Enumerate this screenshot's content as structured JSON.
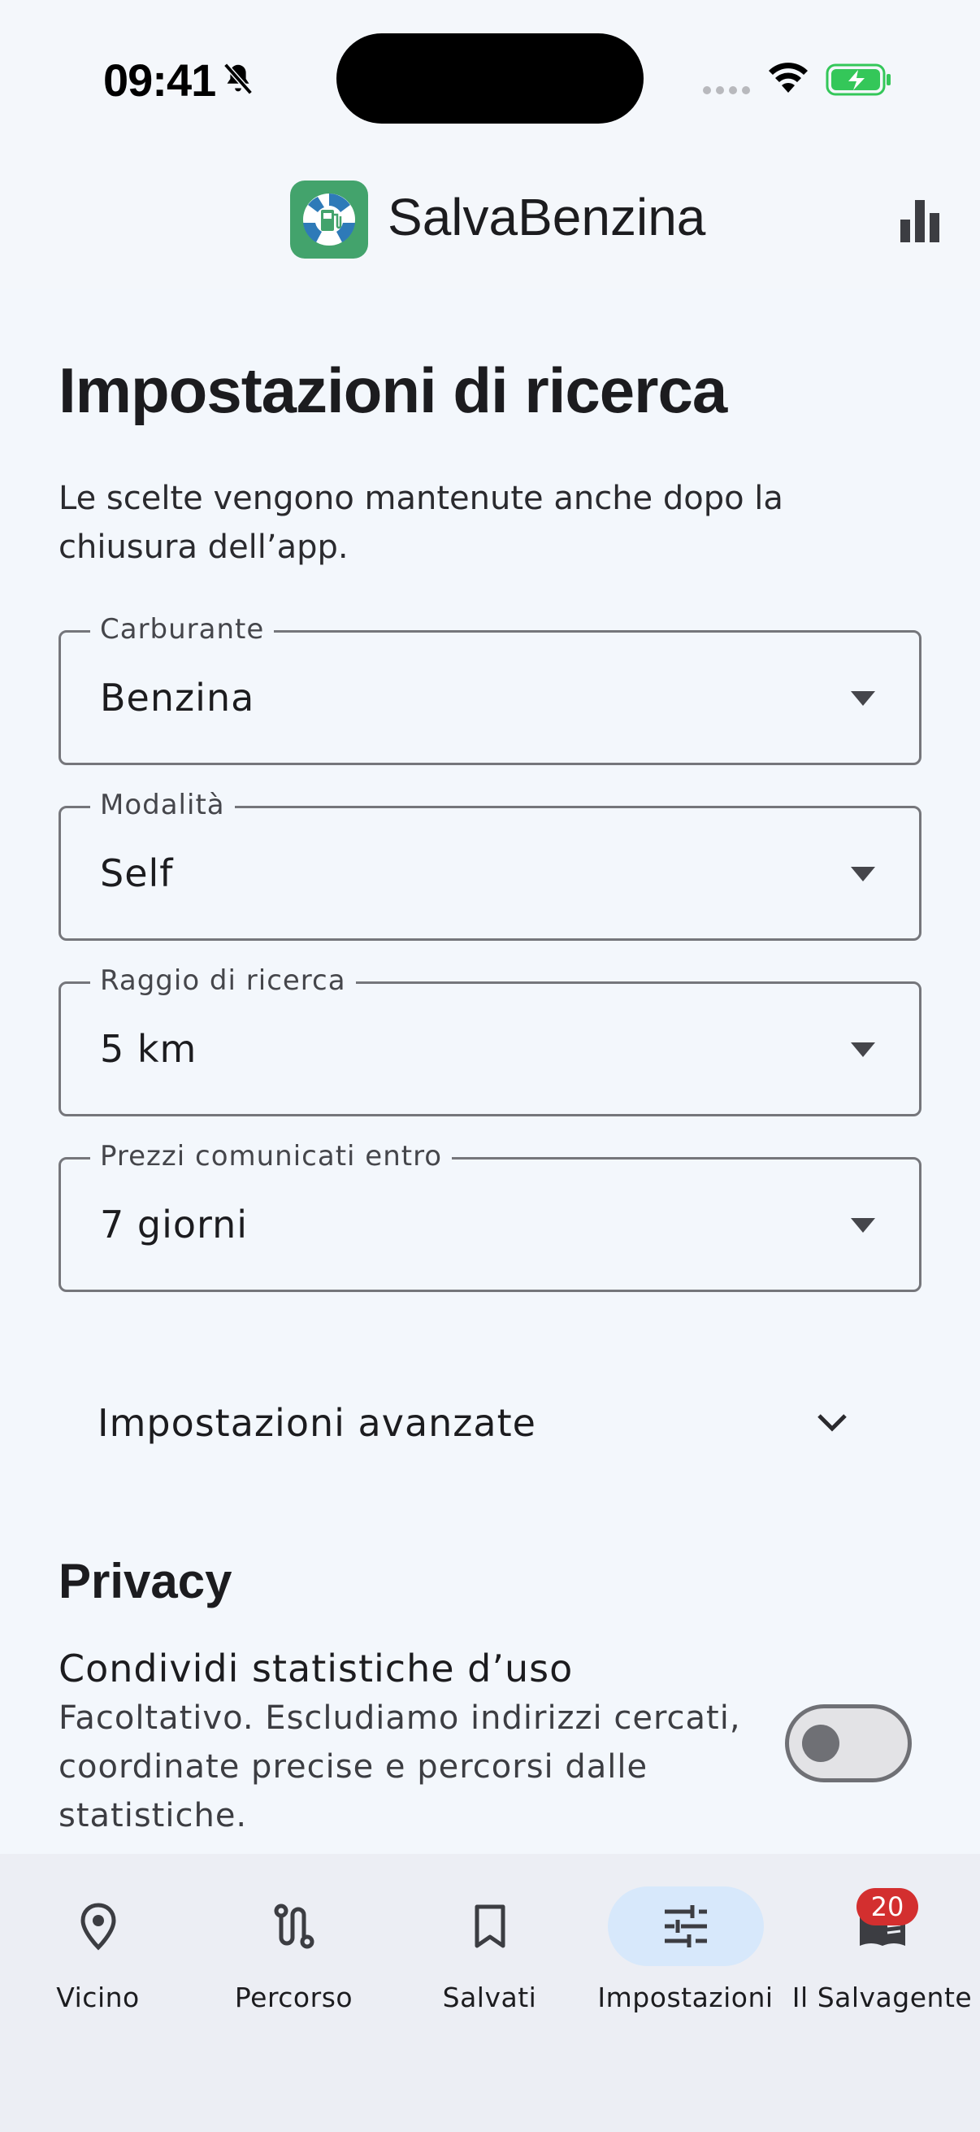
{
  "status_bar": {
    "time": "09:41"
  },
  "app_bar": {
    "title": "SalvaBenzina",
    "logo_icon": "fuel-lifebuoy-icon",
    "action_icon": "bar-chart-icon"
  },
  "page": {
    "title": "Impostazioni di ricerca",
    "description": "Le scelte vengono mantenute anche dopo la chiusura dell’app."
  },
  "fields": [
    {
      "label": "Carburante",
      "value": "Benzina"
    },
    {
      "label": "Modalità",
      "value": "Self"
    },
    {
      "label": "Raggio di ricerca",
      "value": "5 km"
    },
    {
      "label": "Prezzi comunicati entro",
      "value": "7 giorni"
    }
  ],
  "advanced": {
    "label": "Impostazioni avanzate",
    "expanded": false
  },
  "privacy": {
    "title": "Privacy",
    "share_stats": {
      "title": "Condividi statistiche d’uso",
      "description": "Facoltativo. Escludiamo indirizzi cercati, coordinate precise e percorsi dalle statistiche.",
      "enabled": false
    }
  },
  "bottom_nav": {
    "items": [
      {
        "label": "Vicino",
        "icon": "location-pin-icon",
        "active": false
      },
      {
        "label": "Percorso",
        "icon": "route-icon",
        "active": false
      },
      {
        "label": "Salvati",
        "icon": "bookmark-icon",
        "active": false
      },
      {
        "label": "Impostazioni",
        "icon": "sliders-icon",
        "active": true
      },
      {
        "label": "Il Salvagente",
        "icon": "book-icon",
        "active": false,
        "badge": "20"
      }
    ]
  },
  "colors": {
    "background": "#f3f7fc",
    "brand": "#43a36c",
    "active_pill": "#d7e8fb",
    "badge": "#d32f2f"
  }
}
